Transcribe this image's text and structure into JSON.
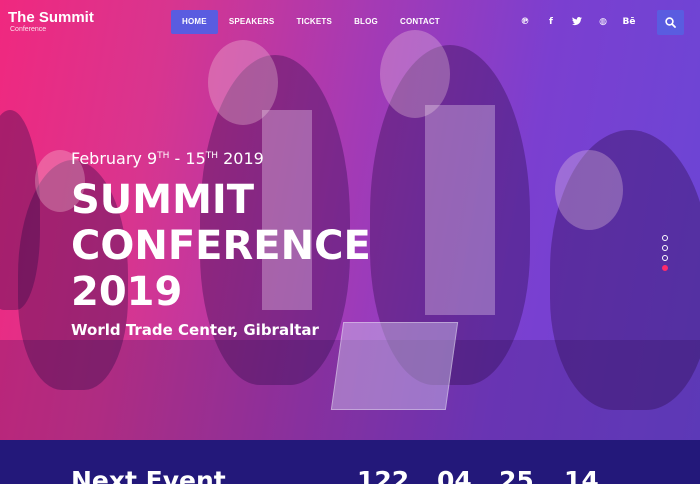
{
  "brand": {
    "title": "The Summit",
    "subtitle": "Conference"
  },
  "nav": {
    "items": [
      {
        "label": "HOME",
        "active": true
      },
      {
        "label": "SPEAKERS",
        "active": false
      },
      {
        "label": "TICKETS",
        "active": false
      },
      {
        "label": "BLOG",
        "active": false
      },
      {
        "label": "CONTACT",
        "active": false
      }
    ]
  },
  "social": {
    "icons": [
      {
        "name": "pinterest-icon",
        "glyph": "℗"
      },
      {
        "name": "facebook-icon",
        "glyph": "f"
      },
      {
        "name": "twitter-icon",
        "glyph": "🐦"
      },
      {
        "name": "dribbble-icon",
        "glyph": "◍"
      },
      {
        "name": "behance-icon",
        "glyph": "Bē"
      }
    ]
  },
  "hero": {
    "date_start": "February 9",
    "date_start_sup": "TH",
    "date_separator": " - 15",
    "date_end_sup": "TH",
    "date_year": " 2019",
    "headline_line1": "SUMMIT",
    "headline_line2": "CONFERENCE",
    "headline_line3": "2019",
    "venue": "World Trade Center, Gibraltar"
  },
  "slider": {
    "count": 4,
    "active_index": 3
  },
  "countdown": {
    "label": "Next Event",
    "values": [
      "122",
      "04",
      "25",
      "14"
    ]
  },
  "colors": {
    "accent": "#5a5ce0",
    "slider_active": "#ff2b6a",
    "bottom_bar": "#23187a",
    "gradient_start": "#f0287f",
    "gradient_end": "#6a46d6"
  }
}
